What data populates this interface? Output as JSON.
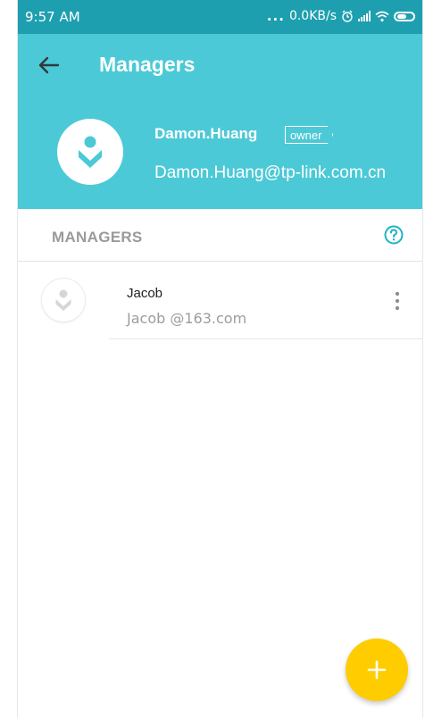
{
  "status_bar": {
    "time": "9:57 AM",
    "dots": "...",
    "network_speed": "0.0KB/s",
    "icons": [
      "alarm-icon",
      "signal-icon",
      "wifi-icon",
      "battery-icon"
    ]
  },
  "header": {
    "title": "Managers",
    "back_icon": "back-arrow-icon",
    "background_color": "#4cc9d6"
  },
  "owner": {
    "name": "Damon.Huang",
    "badge": "owner",
    "email": "Damon.Huang@tp-link.com.cn",
    "avatar_icon": "user-avatar-icon"
  },
  "managers_section": {
    "title": "MANAGERS",
    "help_icon": "help-icon",
    "accent_color": "#1fb3c4"
  },
  "managers": [
    {
      "name": "Jacob",
      "email": "Jacob @163.com",
      "avatar_icon": "user-avatar-icon",
      "menu_icon": "more-vertical-icon"
    }
  ],
  "fab": {
    "icon": "plus-icon",
    "color": "#ffcc00"
  }
}
